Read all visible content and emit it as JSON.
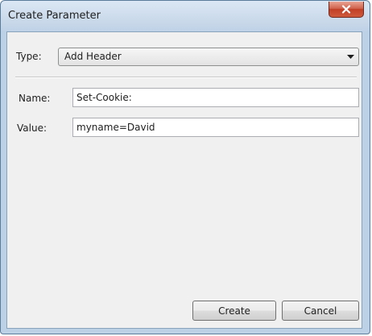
{
  "window": {
    "title": "Create Parameter"
  },
  "form": {
    "type_label": "Type:",
    "type_value": "Add Header",
    "name_label": "Name:",
    "name_value": "Set-Cookie:",
    "value_label": "Value:",
    "value_value": "myname=David"
  },
  "buttons": {
    "create": "Create",
    "cancel": "Cancel"
  },
  "colors": {
    "close_button": "#c13f26",
    "frame": "#bcd0e6",
    "client_bg": "#f0f0f0"
  }
}
